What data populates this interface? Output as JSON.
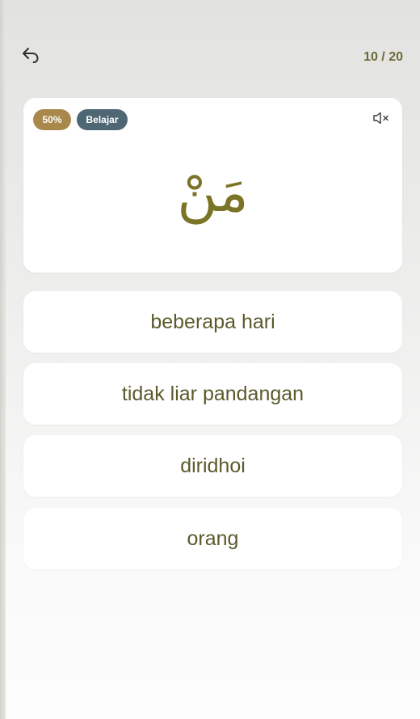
{
  "header": {
    "back_icon": "back-arrow-icon",
    "progress": "10 / 20"
  },
  "word_card": {
    "percent_badge": "50%",
    "mode_badge": "Belajar",
    "mute_icon": "speaker-muted-icon",
    "arabic_word": "مَنْ",
    "colors": {
      "percent_badge": "#a8884b",
      "mode_badge": "#4f6774",
      "arabic_text": "#7a7426"
    }
  },
  "options": [
    {
      "label": "beberapa hari"
    },
    {
      "label": "tidak liar pandangan"
    },
    {
      "label": "diridhoi"
    },
    {
      "label": "orang"
    }
  ]
}
